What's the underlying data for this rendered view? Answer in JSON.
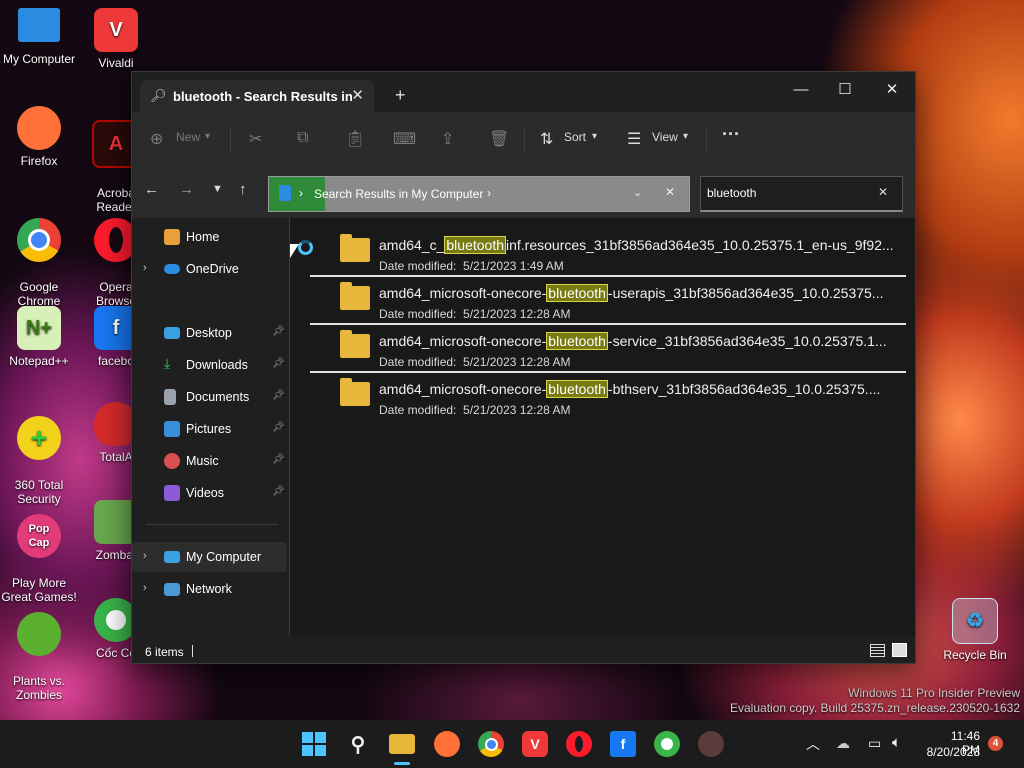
{
  "desktop": {
    "icons": [
      {
        "label": "My Computer",
        "icon": "my-computer-icon",
        "color": "#2b8be0"
      },
      {
        "label": "Vivaldi",
        "icon": "vivaldi-icon",
        "color": "#ef3939"
      },
      {
        "label": "Firefox",
        "icon": "firefox-icon",
        "color": "#ff7139"
      },
      {
        "label": "Acroba\nReader",
        "icon": "acrobat-icon",
        "color": "#b30b00"
      },
      {
        "label": "Google\nChrome",
        "icon": "chrome-icon",
        "color": "#4285f4"
      },
      {
        "label": "Opera\nBrowse",
        "icon": "opera-icon",
        "color": "#ff1b2d"
      },
      {
        "label": "Notepad++",
        "icon": "notepadpp-icon",
        "color": "#8fd14f"
      },
      {
        "label": "facebo",
        "icon": "facebook-icon",
        "color": "#1877f2"
      },
      {
        "label": "360 Total\nSecurity",
        "icon": "360-security-icon",
        "color": "#2ecc40"
      },
      {
        "label": "TotalA",
        "icon": "totalav-icon",
        "color": "#d62b2b"
      },
      {
        "label": "Play More\nGreat Games!",
        "icon": "popcap-icon",
        "color": "#e23b7a"
      },
      {
        "label": "Zombat",
        "icon": "zombatar-icon",
        "color": "#6aa84f"
      },
      {
        "label": "Plants vs.\nZombies",
        "icon": "pvz-icon",
        "color": "#5bb030"
      },
      {
        "label": "Cốc Cố",
        "icon": "coccoc-icon",
        "color": "#39b54a"
      },
      {
        "label": "Recycle Bin",
        "icon": "recycle-bin-icon",
        "color": "#8ab4d8"
      }
    ],
    "watermark_line1": "Windows 11 Pro Insider Preview",
    "watermark_line2": "Evaluation copy. Build 25375.zn_release.230520-1632"
  },
  "window": {
    "tab_title": "bluetooth - Search Results in",
    "toolbar": {
      "new_label": "New",
      "sort_label": "Sort",
      "view_label": "View",
      "more_label": "···"
    },
    "address": {
      "path": "Search Results in My Computer"
    },
    "search": {
      "value": "bluetooth"
    },
    "sidebar": {
      "home": "Home",
      "onedrive": "OneDrive",
      "desktop": "Desktop",
      "downloads": "Downloads",
      "documents": "Documents",
      "pictures": "Pictures",
      "music": "Music",
      "videos": "Videos",
      "my_computer": "My Computer",
      "network": "Network"
    },
    "results": [
      {
        "pre": "amd64_c_",
        "hit": "bluetooth",
        "post": "inf.resources_31bf3856ad364e35_10.0.25375.1_en-us_9f92...",
        "date_label": "Date modified:",
        "date": "5/21/2023 1:49 AM"
      },
      {
        "pre": "amd64_microsoft-onecore-",
        "hit": "bluetooth",
        "post": "-userapis_31bf3856ad364e35_10.0.25375...",
        "date_label": "Date modified:",
        "date": "5/21/2023 12:28 AM"
      },
      {
        "pre": "amd64_microsoft-onecore-",
        "hit": "bluetooth",
        "post": "-service_31bf3856ad364e35_10.0.25375.1...",
        "date_label": "Date modified:",
        "date": "5/21/2023 12:28 AM"
      },
      {
        "pre": "amd64_microsoft-onecore-",
        "hit": "bluetooth",
        "post": "-bthserv_31bf3856ad364e35_10.0.25375....",
        "date_label": "Date modified:",
        "date": "5/21/2023 12:28 AM"
      }
    ],
    "status": {
      "items": "6 items"
    }
  },
  "taskbar": {
    "time": "11:46 PM",
    "date": "8/20/2023",
    "notifications": "4"
  },
  "colors": {
    "accent": "#4cc2ff",
    "highlight": "#d6d650",
    "folder": "#e8b73a"
  }
}
